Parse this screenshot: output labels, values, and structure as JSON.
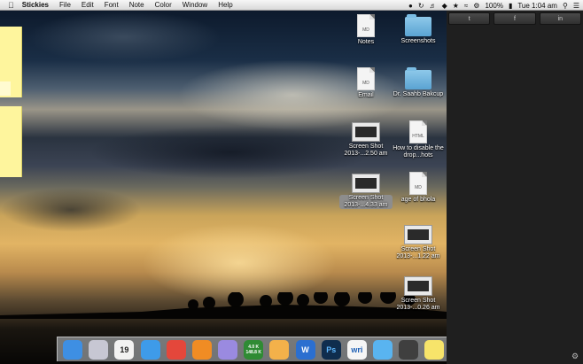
{
  "menubar": {
    "apple": "",
    "app_name": "Stickies",
    "menus": [
      "File",
      "Edit",
      "Font",
      "Note",
      "Color",
      "Window",
      "Help"
    ],
    "status": {
      "battery": "100%",
      "clock": "Tue 1:04 am"
    }
  },
  "desktop_icons": [
    {
      "label": "Notes",
      "kind": "doc",
      "tag": "MD"
    },
    {
      "label": "Screenshots",
      "kind": "folder"
    },
    {
      "label": "Email",
      "kind": "doc",
      "tag": "MD"
    },
    {
      "label": "Dr. Saahb Bakcup",
      "kind": "folder"
    },
    {
      "label": "Screen Shot 2013-...2.50 am",
      "kind": "shot"
    },
    {
      "label": "How to disable the drop...hots",
      "kind": "doc",
      "tag": "HTML"
    },
    {
      "label": "Screen Shot 2013-...4.33 am",
      "kind": "shot"
    },
    {
      "label": "age of bhola",
      "kind": "doc",
      "tag": "MD"
    },
    {
      "label": "Screen Shot 2013-...1.22 am",
      "kind": "shot"
    },
    {
      "label": "Screen Shot 2013-...0.26 am",
      "kind": "shot"
    }
  ],
  "dock": {
    "items": [
      {
        "name": "finder",
        "color": "#3e8fe3"
      },
      {
        "name": "launchpad",
        "color": "#c7c7d3"
      },
      {
        "name": "calendar",
        "color": "#f2f2f2",
        "text": "19"
      },
      {
        "name": "safari",
        "color": "#3e9be9"
      },
      {
        "name": "chrome",
        "color": "#e4473b"
      },
      {
        "name": "ibooks",
        "color": "#f08c24"
      },
      {
        "name": "preview",
        "color": "#9a8ae0"
      },
      {
        "name": "netspeed",
        "color": "#2f8b34",
        "text": "4.0 K 148.8 K"
      },
      {
        "name": "pages",
        "color": "#f3b14a"
      },
      {
        "name": "word",
        "color": "#2b6fd0",
        "text": "W"
      },
      {
        "name": "photoshop",
        "color": "#0f2d4e",
        "text": "Ps"
      },
      {
        "name": "writer",
        "color": "#f5f5f5",
        "text": "wri"
      },
      {
        "name": "messages",
        "color": "#59b4f0"
      },
      {
        "name": "grapher",
        "color": "#3f3f3f"
      },
      {
        "name": "stickies",
        "color": "#f7e46a"
      },
      {
        "name": "vlc",
        "color": "#f07f1f"
      },
      {
        "name": "terminal",
        "color": "#1a1a1a",
        "text": ">_"
      },
      {
        "name": "trash",
        "color": "#bfc3c7"
      }
    ]
  },
  "sidebar": {
    "share_buttons": [
      {
        "name": "twitter",
        "glyph": "t"
      },
      {
        "name": "facebook",
        "glyph": "f"
      },
      {
        "name": "linkedin",
        "glyph": "in"
      }
    ]
  },
  "colors": {
    "sticky": "#fef59d",
    "sidebar": "#1f1f1f",
    "menubar": "#e8e8e8"
  }
}
